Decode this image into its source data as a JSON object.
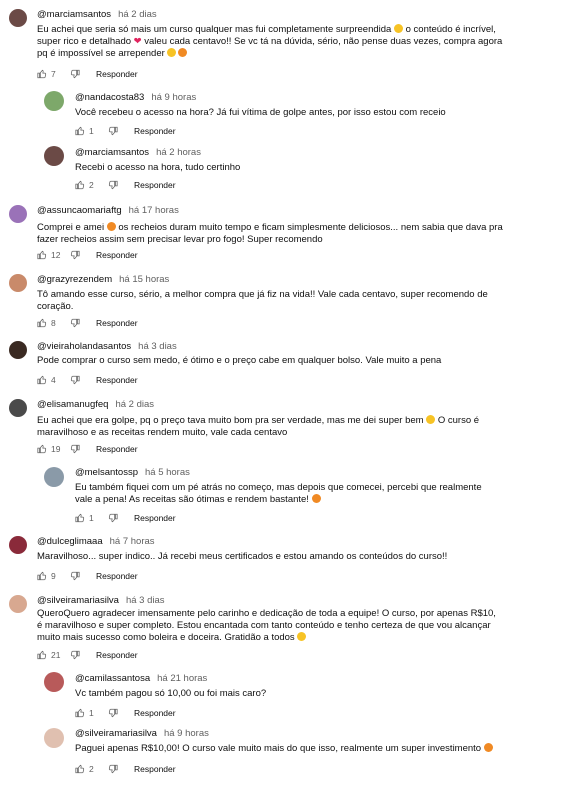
{
  "actions": {
    "reply_label": "Responder"
  },
  "comments": [
    {
      "user": "@marciamsantos",
      "time": "há 2 dias",
      "text_parts": [
        "Eu achei que seria só mais um curso qualquer mas fui completamente surpreendida ",
        " o conteúdo é incrível, super rico e detalhado ",
        " valeu cada centavo!! Se vc tá na dúvida, sério, não pense duas vezes, compra agora pq é impossível se arrepender ",
        ""
      ],
      "likes": "7"
    },
    {
      "user": "@nandacosta83",
      "time": "há 9 horas",
      "text": "Você recebeu o acesso na hora? Já fui vítima de golpe antes, por isso estou com receio",
      "likes": "1"
    },
    {
      "user": "@marciamsantos",
      "time": "há 2 horas",
      "text": "Recebi o acesso na hora, tudo certinho",
      "likes": "2"
    },
    {
      "user": "@assuncaomariaftg",
      "time": "há 17 horas",
      "text_parts": [
        "Comprei e amei ",
        " os recheios duram muito tempo e ficam simplesmente deliciosos... nem sabia que dava pra fazer recheios assim sem precisar levar pro fogo! Super recomendo"
      ],
      "likes": "12"
    },
    {
      "user": "@grazyrezendem",
      "time": "há 15 horas",
      "text": "Tô amando esse curso, sério, a melhor compra que já fiz na vida!! Vale cada centavo, super recomendo de coração.",
      "likes": "8"
    },
    {
      "user": "@vieiraholandasantos",
      "time": "há 3 dias",
      "text": "Pode comprar o curso sem medo, é ótimo e o preço cabe em qualquer bolso. Vale muito a pena",
      "likes": "4"
    },
    {
      "user": "@elisamanugfeq",
      "time": "há 2 dias",
      "text_parts": [
        "Eu achei que era golpe, pq o preço tava muito bom pra ser verdade, mas me dei super bem ",
        " O curso é maravilhoso e as receitas rendem muito, vale cada centavo"
      ],
      "likes": "19"
    },
    {
      "user": "@melsantossp",
      "time": "há 5 horas",
      "text_parts": [
        "Eu também fiquei com um pé atrás no começo, mas depois que comecei, percebi que realmente vale a pena! As receitas são ótimas e rendem bastante! ",
        ""
      ],
      "likes": "1"
    },
    {
      "user": "@dulceglimaaa",
      "time": "há 7 horas",
      "text": "Maravilhoso... super indico.. Já recebi meus certificados e estou amando os conteúdos do curso!!",
      "likes": "9"
    },
    {
      "user": "@silveiramariasilva",
      "time": "há 3 dias",
      "text_parts": [
        "QueroQuero agradecer imensamente pelo carinho e dedicação de toda a equipe! O curso, por apenas R$10, é maravilhoso e super completo. Estou encantada com tanto conteúdo e tenho certeza de que vou alcançar muito mais sucesso como boleira e doceira. Gratidão a todos ",
        ""
      ],
      "likes": "21"
    },
    {
      "user": "@camilassantosa",
      "time": "há 21 horas",
      "text": "Vc também pagou só 10,00 ou foi mais caro?",
      "likes": "1"
    },
    {
      "user": "@silveiramariasilva",
      "time": "há 9 horas",
      "text_parts": [
        "Paguei apenas R$10,00! O curso vale muito mais do que isso, realmente um super investimento ",
        ""
      ],
      "likes": "2"
    }
  ],
  "colors": {
    "meta": "#606060",
    "text": "#0f0f0f",
    "heart": "#e0245e",
    "emoji_yellow": "#f7c325",
    "emoji_orange": "#f08a24"
  }
}
